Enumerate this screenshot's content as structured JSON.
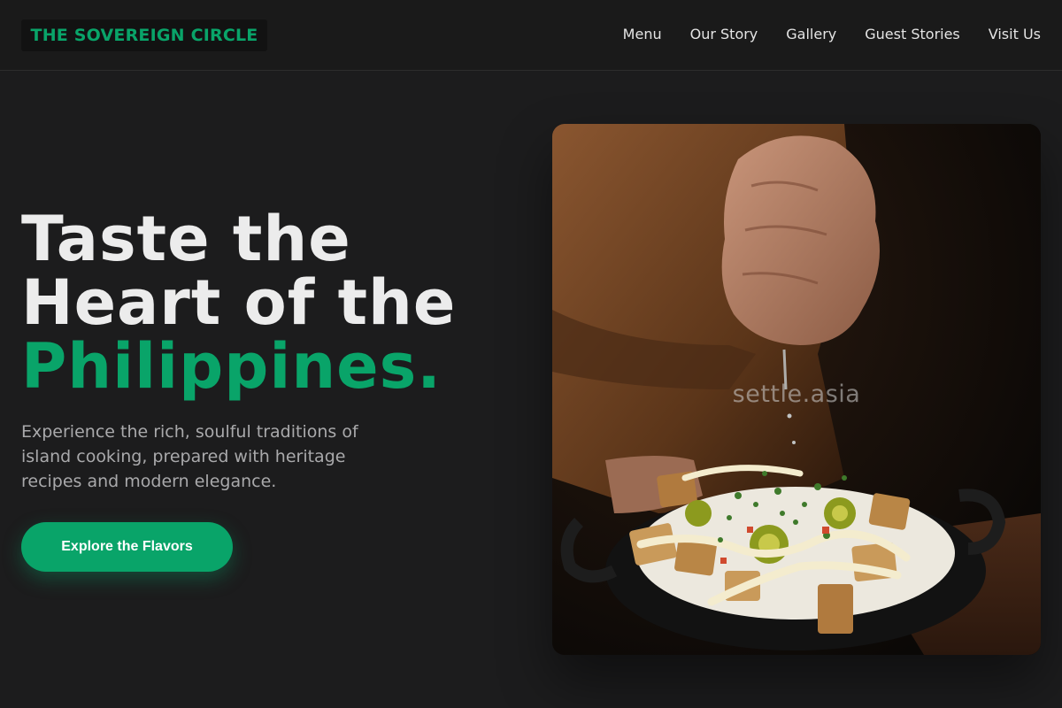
{
  "brand": {
    "name": "THE SOVEREIGN CIRCLE"
  },
  "nav": {
    "items": [
      {
        "label": "Menu"
      },
      {
        "label": "Our Story"
      },
      {
        "label": "Gallery"
      },
      {
        "label": "Guest Stories"
      },
      {
        "label": "Visit Us"
      }
    ]
  },
  "hero": {
    "title_line1": "Taste the",
    "title_line2": "Heart of the",
    "title_accent": "Philippines.",
    "subtitle": "Experience the rich, soulful traditions of island cooking, prepared with heritage recipes and modern elegance.",
    "cta_label": "Explore the Flavors",
    "image_watermark": "settle.asia"
  },
  "colors": {
    "accent": "#09a469",
    "background": "#1c1c1d",
    "text": "#ececec",
    "muted_text": "#a9a9ab"
  }
}
